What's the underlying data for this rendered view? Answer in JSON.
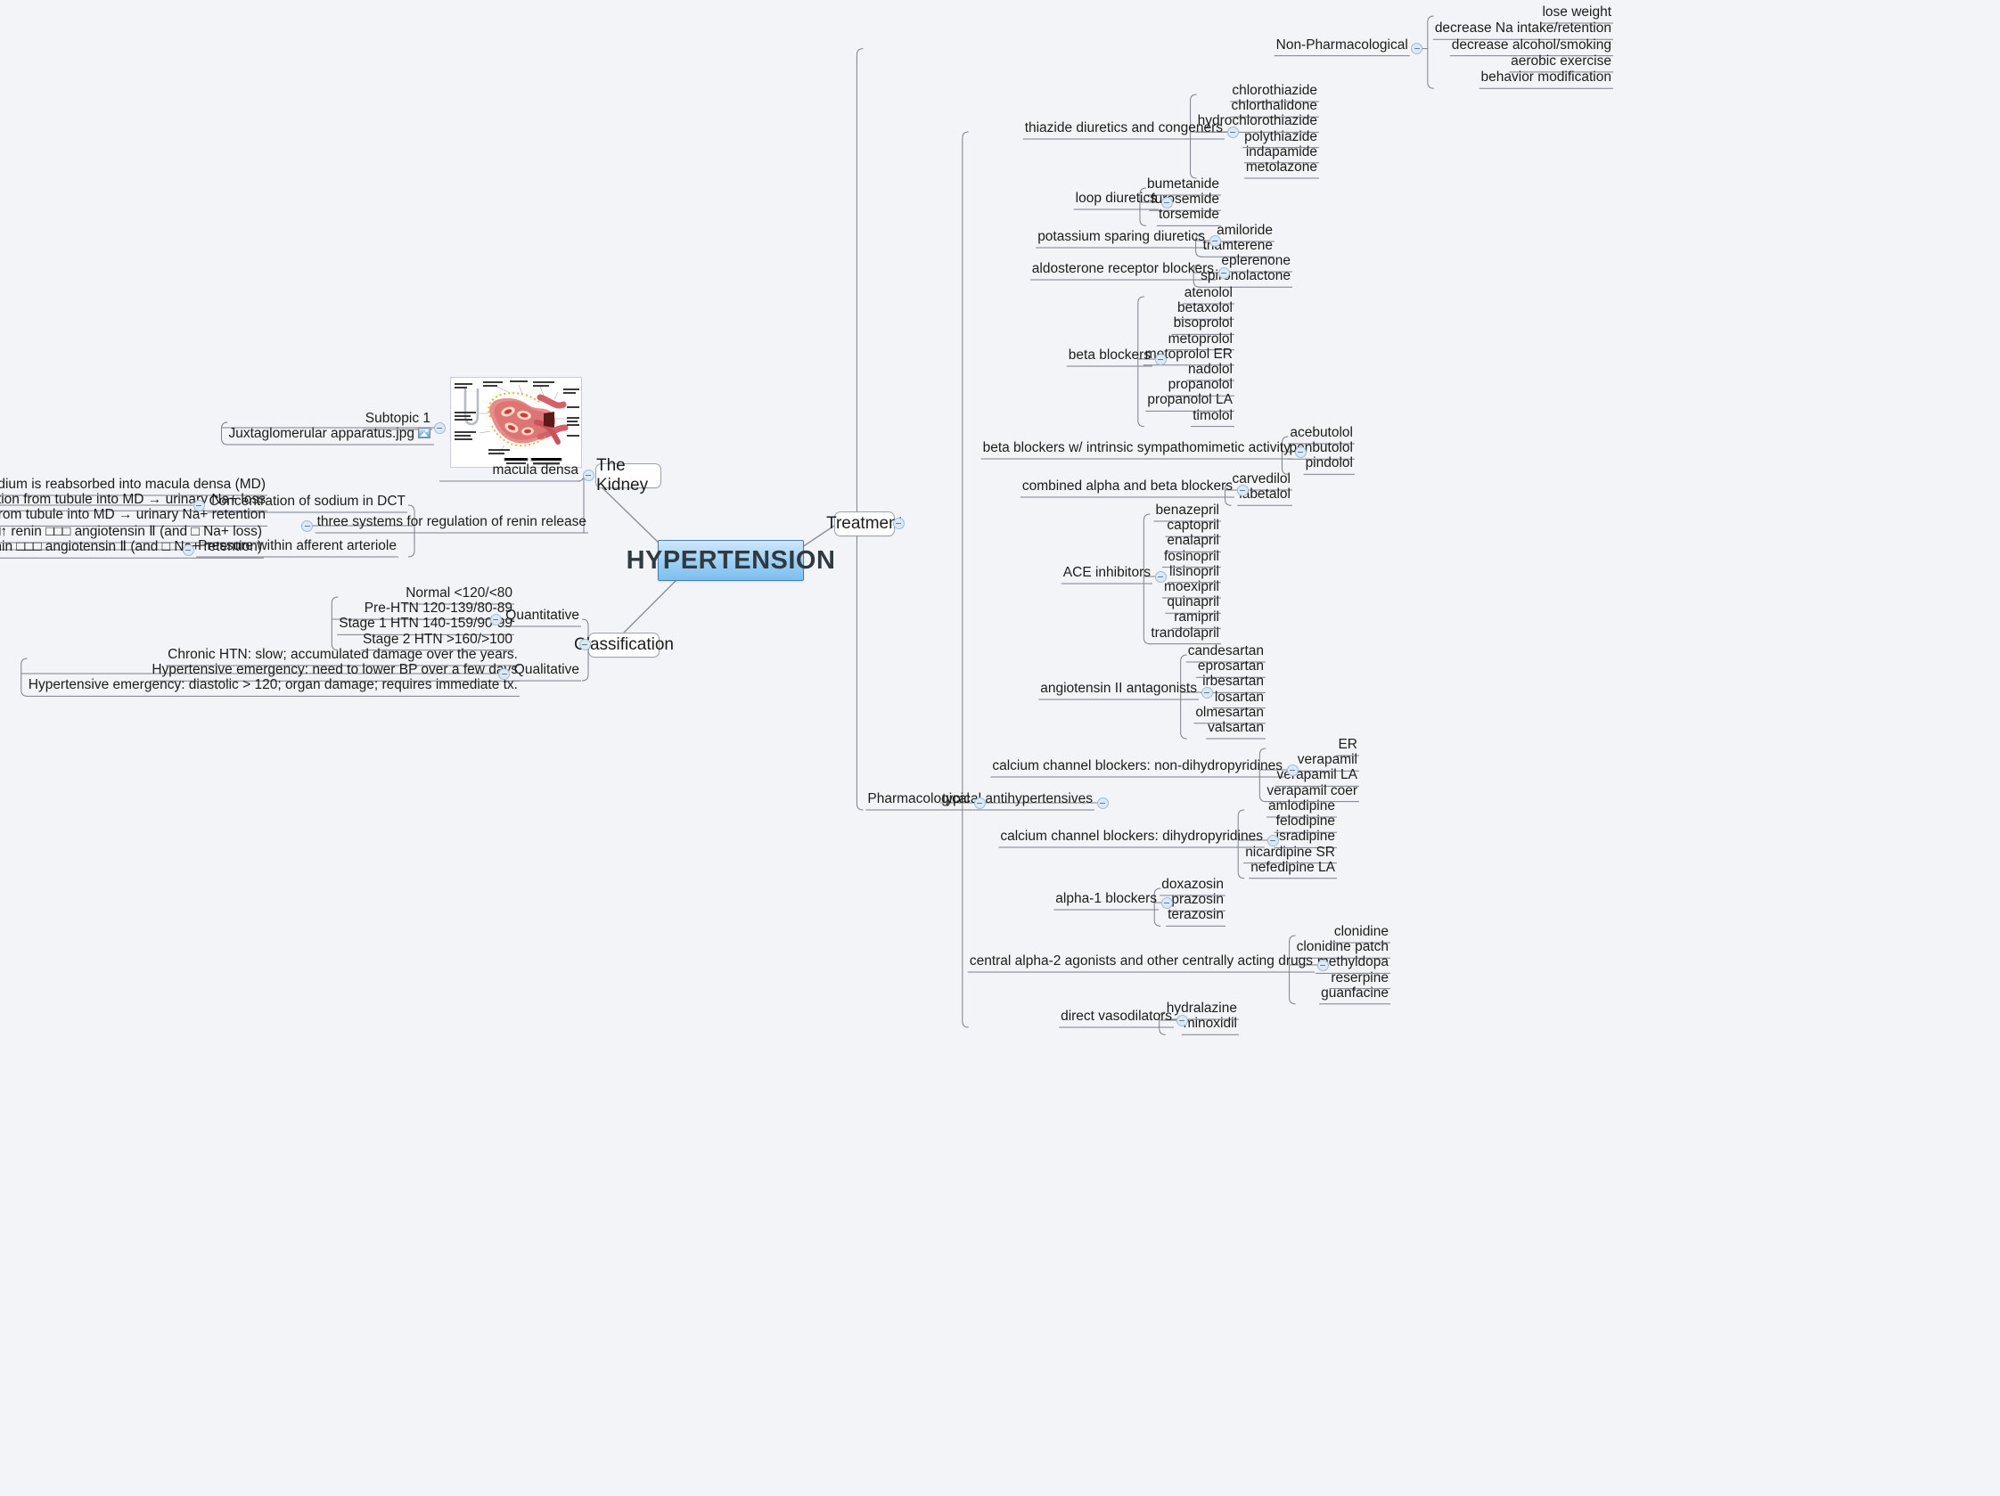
{
  "root": {
    "label": "HYPERTENSION",
    "accent": "#7cc0f0",
    "border": "#4a80a8"
  },
  "background": "#f2f4f7",
  "branches": {
    "treatment": {
      "label": "Treatment"
    },
    "classification": {
      "label": "Classification"
    },
    "kidney": {
      "label": "The Kidney"
    }
  },
  "treatment": {
    "non_pharmacological": {
      "label": "Non-Pharmacological",
      "items": [
        "lose weight",
        "decrease Na intake/retention",
        "decrease alcohol/smoking",
        "aerobic exercise",
        "behavior modification"
      ]
    },
    "pharmacological": {
      "label": "Pharmacological",
      "typical": {
        "label": "typical antihypertensives",
        "classes": [
          {
            "label": "thiazide diuretics and congeners",
            "drugs": [
              "chlorothiazide",
              "chlorthalidone",
              "hydrochlorothiazide",
              "polythiazide",
              "indapamide",
              "metolazone"
            ]
          },
          {
            "label": "loop diuretics",
            "drugs": [
              "bumetanide",
              "furosemide",
              "torsemide"
            ]
          },
          {
            "label": "potassium sparing diuretics",
            "drugs": [
              "amiloride",
              "triamterene"
            ]
          },
          {
            "label": "aldosterone receptor blockers",
            "drugs": [
              "eplerenone",
              "spironolactone"
            ]
          },
          {
            "label": "beta blockers",
            "drugs": [
              "atenolol",
              "betaxolol",
              "bisoprolol",
              "metoprolol",
              "metoprolol ER",
              "nadolol",
              "propanolol",
              "propanolol LA",
              "timolol"
            ]
          },
          {
            "label": "beta blockers w/ intrinsic sympathomimetic activity",
            "drugs": [
              "acebutolol",
              "penbutolol",
              "pindolol"
            ]
          },
          {
            "label": "combined alpha and beta blockers",
            "drugs": [
              "carvedilol",
              "labetalol"
            ]
          },
          {
            "label": "ACE inhibitors",
            "drugs": [
              "benazepril",
              "captopril",
              "enalapril",
              "fosinopril",
              "lisinopril",
              "moexipril",
              "quinapril",
              "ramipril",
              "trandolapril"
            ]
          },
          {
            "label": "angiotensin II antagonists",
            "drugs": [
              "candesartan",
              "eprosartan",
              "irbesartan",
              "losartan",
              "olmesartan",
              "valsartan"
            ]
          },
          {
            "label": "calcium channel blockers: non-dihydropyridines",
            "drugs": [
              "ER",
              "verapamil",
              "verapamil LA",
              "verapamil coer"
            ]
          },
          {
            "label": "calcium channel blockers: dihydropyridines",
            "drugs": [
              "amlodipine",
              "felodipine",
              "isradipine",
              "nicardipine SR",
              "nefedipine LA"
            ]
          },
          {
            "label": "alpha-1 blockers",
            "drugs": [
              "doxazosin",
              "prazosin",
              "terazosin"
            ]
          },
          {
            "label": "central alpha-2 agonists and other centrally acting drugs",
            "drugs": [
              "clonidine",
              "clonidine patch",
              "methyldopa",
              "reserpine",
              "guanfacine"
            ]
          },
          {
            "label": "direct vasodilators",
            "drugs": [
              "hydralazine",
              "minoxidil"
            ]
          }
        ]
      }
    }
  },
  "classification": {
    "quantitative": {
      "label": "Quantitative",
      "items": [
        "Normal <120/<80",
        "Pre-HTN 120-139/80-89",
        "Stage 1 HTN 140-159/90-99",
        "Stage 2 HTN >160/>100"
      ]
    },
    "qualitative": {
      "label": "Qualitative",
      "items": [
        "Chronic HTN: slow; accumulated damage over the years.",
        "Hypertensive emergency: need to lower BP over a few days",
        "Hypertensive emergency: diastolic > 120; organ damage; requires immediate tx."
      ]
    }
  },
  "kidney": {
    "macula_densa": {
      "label": "macula densa",
      "subtopic": {
        "label": "Subtopic 1"
      },
      "attachment": {
        "label": "Juxtaglomerular apparatus.jpg",
        "icon": "image-attachment-icon"
      }
    },
    "renin": {
      "label": "three systems for regulation of renin release",
      "systems": [
        {
          "label": "Concentration of sodium in DCT",
          "items": [
            "sodium is reabsorbed into macula densa (MD)",
            "↑ Na+ reabsorption from tubule into MD →  urinary Na+ loss",
            "↑ Na+ reabsorption from tubule into MD  →  urinary Na+ retention"
          ]
        },
        {
          "label": "Pressure within afferent arteriole",
          "items": [
            "↑ BP   □□↑ renin □□□ angiotensin Ⅱ (and □ Na+ loss)",
            "□□BP   renin □□□ angiotensin Ⅱ (and □ Na+ retention)"
          ]
        }
      ]
    }
  }
}
